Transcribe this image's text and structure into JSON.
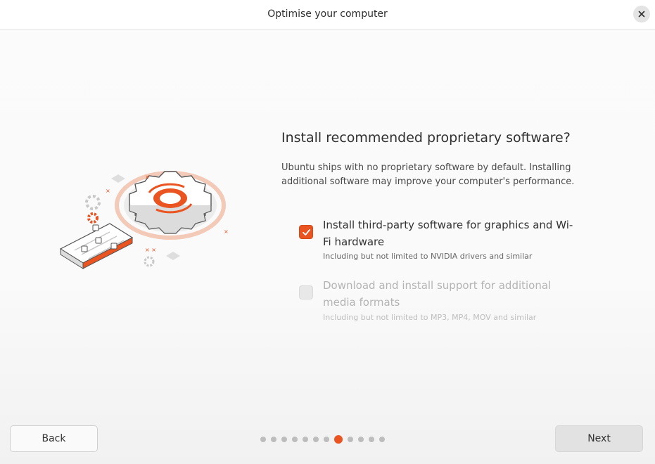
{
  "window": {
    "title": "Optimise your computer",
    "close_icon": "close-icon"
  },
  "main": {
    "heading": "Install recommended proprietary software?",
    "description": "Ubuntu ships with no proprietary software by default. Installing additional software may improve your computer's performance.",
    "illustration_icon": "gear-settings-illustration"
  },
  "options": [
    {
      "label": "Install third-party software for graphics and Wi-Fi hardware",
      "sublabel": "Including but not limited to NVIDIA drivers and similar",
      "checked": true,
      "enabled": true
    },
    {
      "label": "Download and install support for additional media formats",
      "sublabel": "Including but not limited to MP3, MP4, MOV and similar",
      "checked": false,
      "enabled": false
    }
  ],
  "footer": {
    "back_label": "Back",
    "next_label": "Next",
    "progress": {
      "total_steps": 12,
      "current_step": 8
    }
  },
  "colors": {
    "accent": "#e95420",
    "dot_inactive": "#bdbdbd"
  }
}
